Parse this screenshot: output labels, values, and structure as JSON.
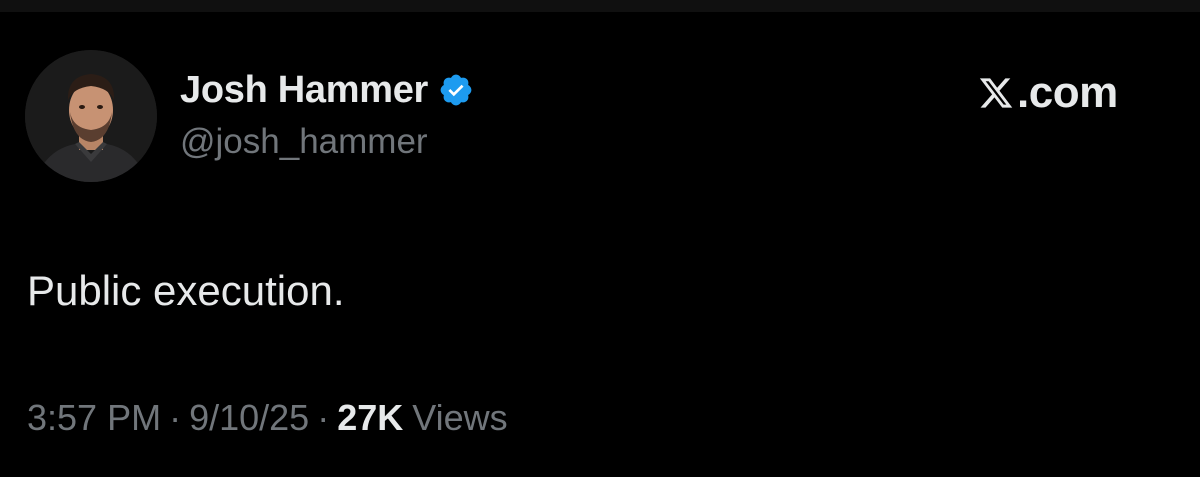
{
  "author": {
    "display_name": "Josh Hammer",
    "handle": "@josh_hammer",
    "verified": true
  },
  "brand": {
    "label": ".com"
  },
  "tweet": {
    "text": "Public execution."
  },
  "meta": {
    "time": "3:57 PM",
    "separator": "·",
    "date": "9/10/25",
    "views_count": "27K",
    "views_label": "Views"
  },
  "colors": {
    "background": "#000000",
    "primary_text": "#e7e9ea",
    "secondary_text": "#71767b",
    "verified_blue": "#1d9bf0"
  },
  "icons": {
    "verified": "verified-badge-icon",
    "brand": "x-logo-icon"
  }
}
